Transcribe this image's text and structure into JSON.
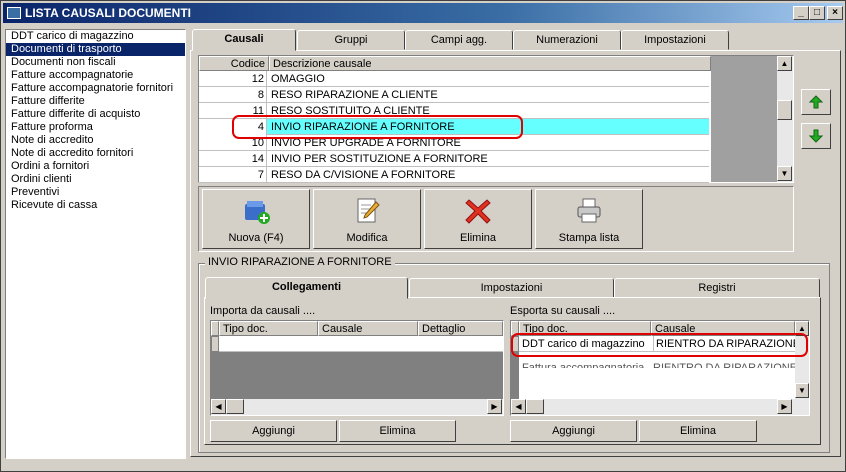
{
  "window": {
    "title": "LISTA CAUSALI DOCUMENTI",
    "min": "_",
    "max": "□",
    "close": "×"
  },
  "doc_types": [
    {
      "label": "DDT carico di magazzino",
      "selected": false
    },
    {
      "label": "Documenti di trasporto",
      "selected": true
    },
    {
      "label": "Documenti non fiscali",
      "selected": false
    },
    {
      "label": "Fatture accompagnatorie",
      "selected": false
    },
    {
      "label": "Fatture accompagnatorie fornitori",
      "selected": false
    },
    {
      "label": "Fatture differite",
      "selected": false
    },
    {
      "label": "Fatture differite di acquisto",
      "selected": false
    },
    {
      "label": "Fatture proforma",
      "selected": false
    },
    {
      "label": "Note di accredito",
      "selected": false
    },
    {
      "label": "Note di accredito fornitori",
      "selected": false
    },
    {
      "label": "Ordini a fornitori",
      "selected": false
    },
    {
      "label": "Ordini clienti",
      "selected": false
    },
    {
      "label": "Preventivi",
      "selected": false
    },
    {
      "label": "Ricevute di cassa",
      "selected": false
    }
  ],
  "tabs": [
    "Causali",
    "Gruppi",
    "Campi agg.",
    "Numerazioni",
    "Impostazioni"
  ],
  "causali_table": {
    "headers": [
      "Codice",
      "Descrizione causale"
    ],
    "rows": [
      {
        "code": "12",
        "desc": "OMAGGIO"
      },
      {
        "code": "8",
        "desc": "RESO RIPARAZIONE A CLIENTE"
      },
      {
        "code": "11",
        "desc": "RESO SOSTITUITO A CLIENTE"
      },
      {
        "code": "4",
        "desc": "INVIO  RIPARAZIONE A FORNITORE"
      },
      {
        "code": "10",
        "desc": "INVIO PER UPGRADE A FORNITORE"
      },
      {
        "code": "14",
        "desc": "INVIO PER SOSTITUZIONE A FORNITORE"
      },
      {
        "code": "7",
        "desc": "RESO DA C/VISIONE A FORNITORE"
      }
    ]
  },
  "actions": {
    "new": "Nuova (F4)",
    "edit": "Modifica",
    "delete": "Elimina",
    "print": "Stampa lista"
  },
  "detail": {
    "group_title": "INVIO  RIPARAZIONE A FORNITORE",
    "subtabs": [
      "Collegamenti",
      "Impostazioni",
      "Registri"
    ],
    "import_label": "Importa da causali ....",
    "import_headers": [
      "Tipo doc.",
      "Causale",
      "Dettaglio"
    ],
    "export_label": "Esporta su causali ....",
    "export_headers": [
      "Tipo doc.",
      "Causale"
    ],
    "export_rows": [
      {
        "tipo": "DDT carico di magazzino",
        "causale": "RIENTRO DA RIPARAZIONE"
      },
      {
        "tipo": "Fattura accompagnatoria",
        "causale": "RIENTRO DA RIPARAZIONE"
      }
    ],
    "add_label": "Aggiungi",
    "delete_label": "Elimina"
  }
}
